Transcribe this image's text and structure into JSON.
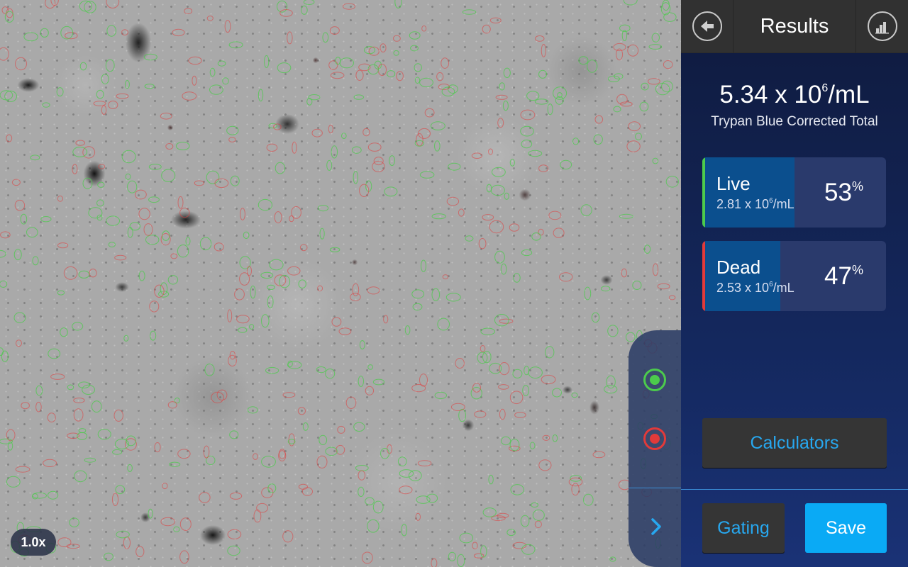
{
  "image_view": {
    "zoom_label": "1.0x"
  },
  "overlay_toggles": {
    "live_color": "#4ccb4c",
    "dead_color": "#e23a3a",
    "expand_icon": "chevron-right-icon"
  },
  "header": {
    "title": "Results",
    "back_icon": "back-arrow-icon",
    "chart_icon": "bar-chart-icon"
  },
  "total": {
    "value": "5.34 x 10",
    "exponent": "6",
    "unit": "/mL",
    "label": "Trypan Blue Corrected Total"
  },
  "live": {
    "label": "Live",
    "conc_value": "2.81 x 10",
    "conc_exponent": "6",
    "conc_unit": "/mL",
    "percent": "53",
    "percent_sign": "%",
    "fraction": 0.53,
    "color": "#4ccb4c"
  },
  "dead": {
    "label": "Dead",
    "conc_value": "2.53 x 10",
    "conc_exponent": "6",
    "conc_unit": "/mL",
    "percent": "47",
    "percent_sign": "%",
    "fraction": 0.47,
    "color": "#e23a3a"
  },
  "buttons": {
    "calculators": "Calculators",
    "gating": "Gating",
    "save": "Save"
  },
  "colors": {
    "accent": "#27a8f0",
    "save_bg": "#0aaaf5",
    "panel_top": "#0f1a3d",
    "panel_bottom": "#1a3276"
  }
}
